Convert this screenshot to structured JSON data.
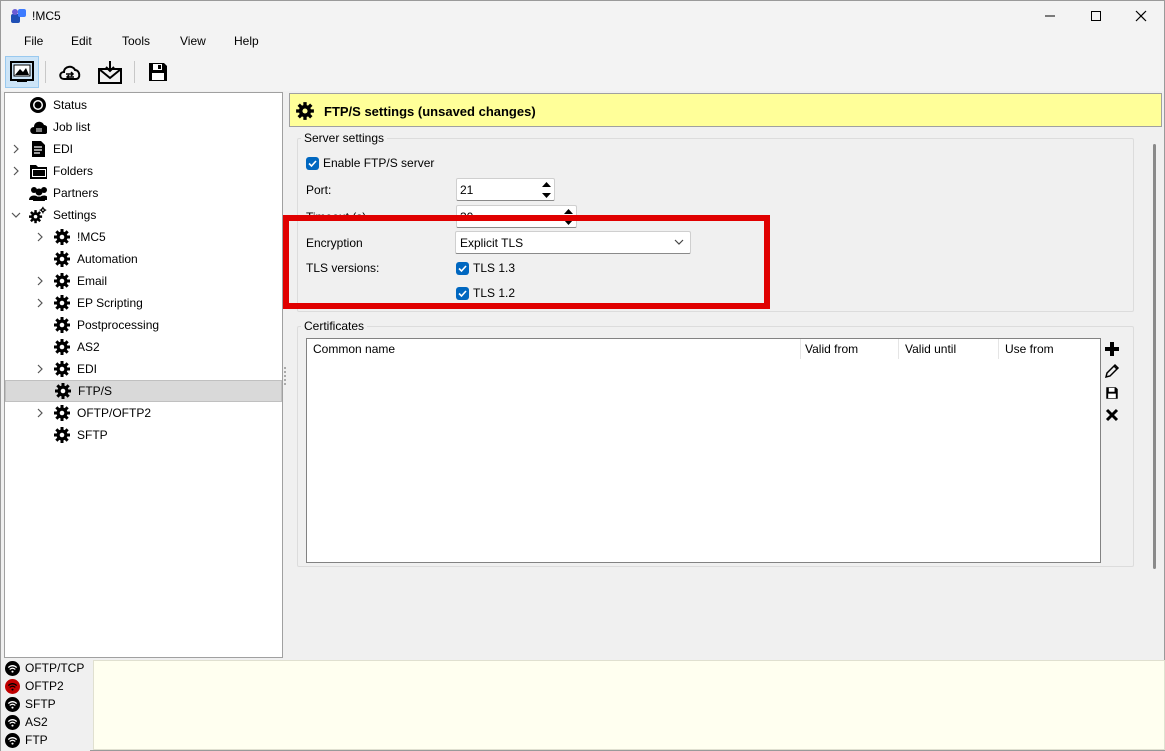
{
  "window": {
    "title": "!MC5"
  },
  "menu": [
    "File",
    "Edit",
    "Tools",
    "View",
    "Help"
  ],
  "toolbar": {
    "buttons": [
      {
        "icon": "image-monitor-icon",
        "active": true
      },
      {
        "icon": "cloud-sync-icon",
        "active": false
      },
      {
        "icon": "mail-download-icon",
        "active": false
      },
      {
        "icon": "save-icon",
        "active": false
      }
    ]
  },
  "tree": {
    "items": [
      {
        "label": "Status",
        "icon": "status-icon"
      },
      {
        "label": "Job list",
        "icon": "cloud-job-icon"
      },
      {
        "label": "EDI",
        "icon": "document-icon",
        "expandable": true
      },
      {
        "label": "Folders",
        "icon": "folder-icon",
        "expandable": true
      },
      {
        "label": "Partners",
        "icon": "partners-icon"
      },
      {
        "label": "Settings",
        "icon": "settings-icon",
        "expanded": true
      },
      {
        "label": "!MC5",
        "icon": "gear-icon",
        "expandable": true
      },
      {
        "label": "Automation",
        "icon": "gear-icon"
      },
      {
        "label": "Email",
        "icon": "gear-icon",
        "expandable": true
      },
      {
        "label": "EP Scripting",
        "icon": "gear-icon",
        "expandable": true
      },
      {
        "label": "Postprocessing",
        "icon": "gear-icon"
      },
      {
        "label": "AS2",
        "icon": "gear-icon"
      },
      {
        "label": "EDI",
        "icon": "gear-icon",
        "expandable": true
      },
      {
        "label": "FTP/S",
        "icon": "gear-icon",
        "selected": true
      },
      {
        "label": "OFTP/OFTP2",
        "icon": "gear-icon",
        "expandable": true
      },
      {
        "label": "SFTP",
        "icon": "gear-icon"
      }
    ]
  },
  "header": {
    "title": "FTP/S settings (unsaved changes)"
  },
  "server_settings": {
    "group_label": "Server settings",
    "enable_label": "Enable FTP/S server",
    "enable_checked": true,
    "port_label": "Port:",
    "port_value": "21",
    "timeout_label": "Timeout (s)",
    "timeout_value": "30",
    "encryption_label": "Encryption",
    "encryption_value": "Explicit TLS",
    "tls_label": "TLS versions:",
    "tls13_label": "TLS 1.3",
    "tls13_checked": true,
    "tls12_label": "TLS 1.2",
    "tls12_checked": true
  },
  "certificates": {
    "group_label": "Certificates",
    "columns": [
      "Common name",
      "Valid from",
      "Valid until",
      "Use from"
    ],
    "rows": []
  },
  "status": {
    "items": [
      {
        "label": "OFTP/TCP",
        "color": "#000000"
      },
      {
        "label": "OFTP2",
        "color": "#c00000"
      },
      {
        "label": "SFTP",
        "color": "#000000"
      },
      {
        "label": "AS2",
        "color": "#000000"
      },
      {
        "label": "FTP",
        "color": "#000000"
      }
    ]
  },
  "colors": {
    "header_bg": "#ffff99",
    "highlight": "#e00000",
    "accent": "#0067c0"
  }
}
